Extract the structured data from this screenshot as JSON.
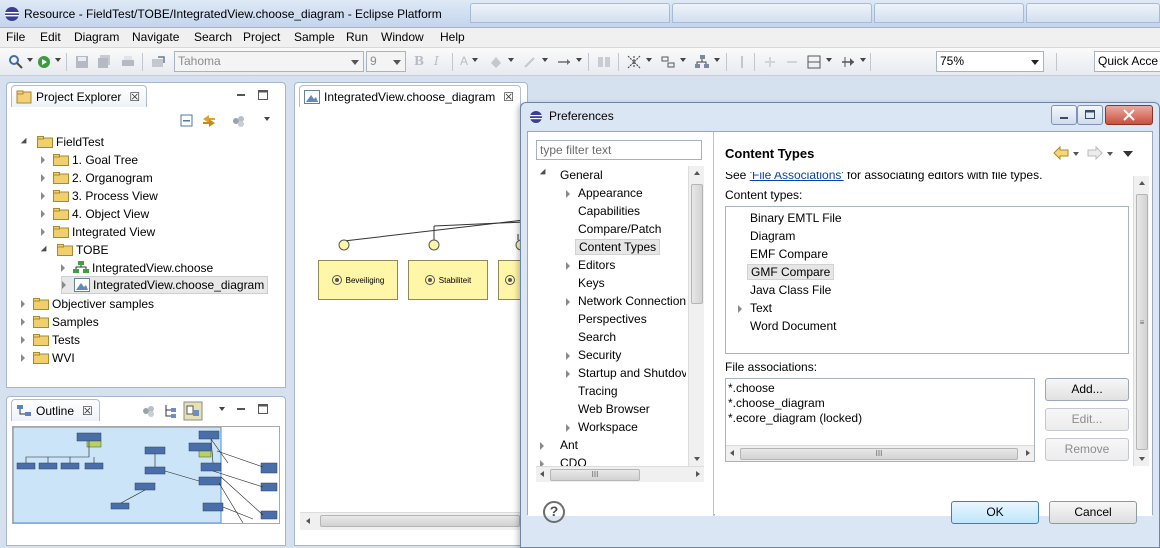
{
  "window": {
    "title": "Resource - FieldTest/TOBE/IntegratedView.choose_diagram - Eclipse Platform"
  },
  "menubar": [
    "File",
    "Edit",
    "Diagram",
    "Navigate",
    "Search",
    "Project",
    "Sample",
    "Run",
    "Window",
    "Help"
  ],
  "toolbar": {
    "font_name": "Tahoma",
    "font_size": "9",
    "zoom": "75%",
    "quick_access": "Quick Acce"
  },
  "project_explorer": {
    "tab_label": "Project Explorer",
    "close_glyph": "☒",
    "items": [
      {
        "label": "FieldTest",
        "state": "open"
      },
      {
        "label": "1. Goal Tree",
        "state": "closed"
      },
      {
        "label": "2. Organogram",
        "state": "closed"
      },
      {
        "label": "3. Process View",
        "state": "closed"
      },
      {
        "label": "4. Object View",
        "state": "closed"
      },
      {
        "label": "Integrated View",
        "state": "closed"
      },
      {
        "label": "TOBE",
        "state": "open"
      },
      {
        "label": "IntegratedView.choose",
        "state": "closed"
      },
      {
        "label": "IntegratedView.choose_diagram",
        "state": "closed"
      },
      {
        "label": "Objectiver samples",
        "state": "closed"
      },
      {
        "label": "Samples",
        "state": "closed"
      },
      {
        "label": "Tests",
        "state": "closed"
      },
      {
        "label": "WVI",
        "state": "closed"
      }
    ]
  },
  "outline": {
    "tab_label": "Outline",
    "close_glyph": "☒"
  },
  "editor": {
    "tab_label": "IntegratedView.choose_diagram",
    "close_glyph": "☒",
    "shapes": [
      "Beveiliging",
      "Stabiliteit"
    ]
  },
  "preferences": {
    "title": "Preferences",
    "filter_placeholder": "type filter text",
    "tree": [
      {
        "label": "General",
        "state": "open"
      },
      {
        "label": "Appearance",
        "state": "closed"
      },
      {
        "label": "Capabilities",
        "state": "leaf"
      },
      {
        "label": "Compare/Patch",
        "state": "leaf"
      },
      {
        "label": "Content Types",
        "state": "leaf",
        "selected": true
      },
      {
        "label": "Editors",
        "state": "closed"
      },
      {
        "label": "Keys",
        "state": "leaf"
      },
      {
        "label": "Network Connection",
        "state": "closed"
      },
      {
        "label": "Perspectives",
        "state": "leaf"
      },
      {
        "label": "Search",
        "state": "leaf"
      },
      {
        "label": "Security",
        "state": "closed"
      },
      {
        "label": "Startup and Shutdov",
        "state": "closed"
      },
      {
        "label": "Tracing",
        "state": "leaf"
      },
      {
        "label": "Web Browser",
        "state": "leaf"
      },
      {
        "label": "Workspace",
        "state": "closed"
      },
      {
        "label": "Ant",
        "state": "closed"
      },
      {
        "label": "CDO",
        "state": "closed"
      }
    ],
    "page_title": "Content Types",
    "intro_before": "See",
    "intro_link": "'File Associations'",
    "intro_after": "for associating editors with file types.",
    "content_types_label": "Content types:",
    "content_types": [
      {
        "label": "Binary EMTL File",
        "twisty": false
      },
      {
        "label": "Diagram",
        "twisty": false
      },
      {
        "label": "EMF Compare",
        "twisty": false
      },
      {
        "label": "GMF Compare",
        "twisty": false,
        "selected": true
      },
      {
        "label": "Java Class File",
        "twisty": false
      },
      {
        "label": "Text",
        "twisty": true
      },
      {
        "label": "Word Document",
        "twisty": false
      }
    ],
    "file_associations_label": "File associations:",
    "file_associations": [
      "*.choose",
      "*.choose_diagram",
      "*.ecore_diagram (locked)"
    ],
    "add_button": "Add...",
    "edit_button": "Edit...",
    "remove_button": "Remove",
    "ok_button": "OK",
    "cancel_button": "Cancel",
    "help_glyph": "?",
    "scroll_grip": "III"
  },
  "colors": {
    "diagram_shape_fill": "#fff6a8",
    "selection_bg": "#e6e6e6",
    "link_color": "#0645ad"
  }
}
